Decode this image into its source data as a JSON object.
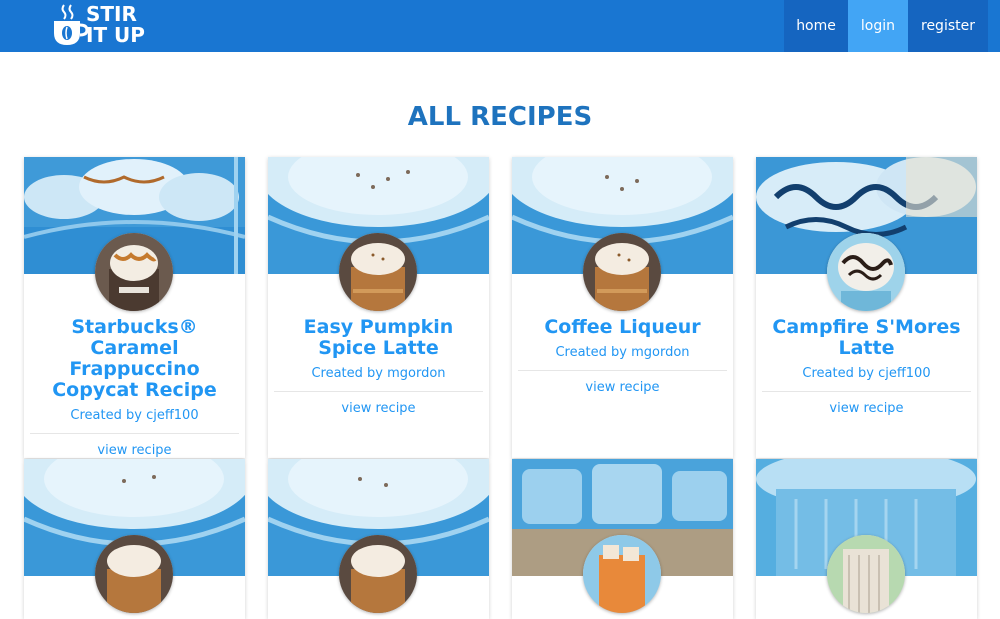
{
  "brand": {
    "logo_line1": "STIR",
    "logo_line2": "IT UP",
    "icon": "coffee-cup-icon",
    "color": "#1976d2"
  },
  "nav": {
    "home": "home",
    "login": "login",
    "register": "register"
  },
  "heading": "ALL RECIPES",
  "recipes": [
    {
      "title": "Starbucks® Caramel Frappuccino Copycat Recipe",
      "author": "Created by cjeff100",
      "link": "view recipe"
    },
    {
      "title": "Easy Pumpkin Spice Latte",
      "author": "Created by mgordon",
      "link": "view recipe"
    },
    {
      "title": "Coffee Liqueur",
      "author": "Created by mgordon",
      "link": "view recipe"
    },
    {
      "title": "Campfire S'Mores Latte",
      "author": "Created by cjeff100",
      "link": "view recipe"
    }
  ],
  "colors": {
    "accent": "#2196f3",
    "heading": "#1e73be",
    "nav_active": "#42a5f5"
  }
}
